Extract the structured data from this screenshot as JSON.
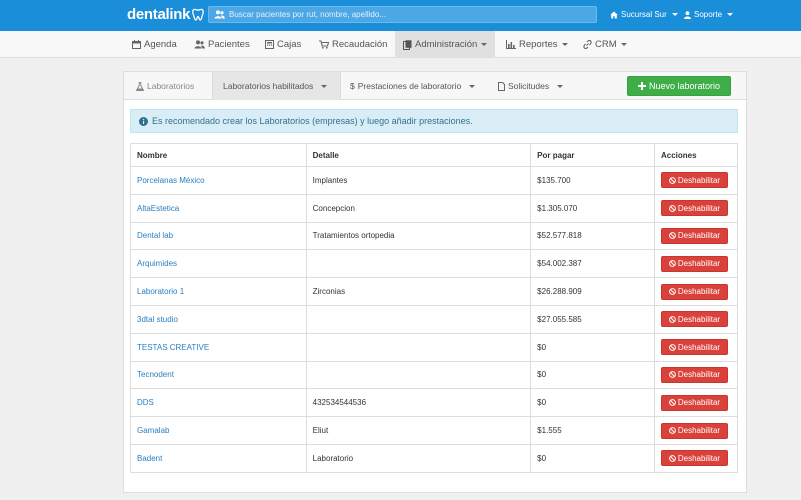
{
  "header": {
    "logo": "dentalink",
    "search_placeholder": "Buscar pacientes por rut, nombre, apellido...",
    "branch": "Sucursal Sur",
    "support": "Soporte"
  },
  "nav": {
    "items": [
      {
        "label": "Agenda",
        "icon": "calendar-icon"
      },
      {
        "label": "Pacientes",
        "icon": "users-icon"
      },
      {
        "label": "Cajas",
        "icon": "cash-register-icon"
      },
      {
        "label": "Recaudación",
        "icon": "cart-icon"
      },
      {
        "label": "Administración",
        "icon": "clipboard-icon"
      },
      {
        "label": "Reportes",
        "icon": "bar-chart-icon"
      },
      {
        "label": "CRM",
        "icon": "link-icon"
      }
    ]
  },
  "tabs": {
    "laboratorios": "Laboratorios",
    "habilitados": "Laboratorios habilitados",
    "prestaciones": "Prestaciones de laboratorio",
    "solicitudes": "Solicitudes",
    "new_button": "Nuevo laboratorio"
  },
  "alert": "Es recomendado crear los Laboratorios (empresas) y luego añadir prestaciones.",
  "table": {
    "headers": [
      "Nombre",
      "Detalle",
      "Por pagar",
      "Acciones"
    ],
    "action_label": "Deshabilitar",
    "rows": [
      {
        "nombre": "Porcelanas México",
        "detalle": "Implantes",
        "por_pagar": "$135.700"
      },
      {
        "nombre": "AltaEstetica",
        "detalle": "Concepcion",
        "por_pagar": "$1.305.070"
      },
      {
        "nombre": "Dental lab",
        "detalle": "Tratamientos ortopedia",
        "por_pagar": "$52.577.818"
      },
      {
        "nombre": "Arquimides",
        "detalle": "",
        "por_pagar": "$54.002.387"
      },
      {
        "nombre": "Laboratorio 1",
        "detalle": "Zirconias",
        "por_pagar": "$26.288.909"
      },
      {
        "nombre": "3dtal studio",
        "detalle": "",
        "por_pagar": "$27.055.585"
      },
      {
        "nombre": "TESTAS CREATIVE",
        "detalle": "",
        "por_pagar": "$0"
      },
      {
        "nombre": "Tecnodent",
        "detalle": "",
        "por_pagar": "$0"
      },
      {
        "nombre": "DDS",
        "detalle": "432534544536",
        "por_pagar": "$0"
      },
      {
        "nombre": "Gamalab",
        "detalle": "Eliut",
        "por_pagar": "$1.555"
      },
      {
        "nombre": "Badent",
        "detalle": "Laboratorio",
        "por_pagar": "$0"
      }
    ]
  }
}
